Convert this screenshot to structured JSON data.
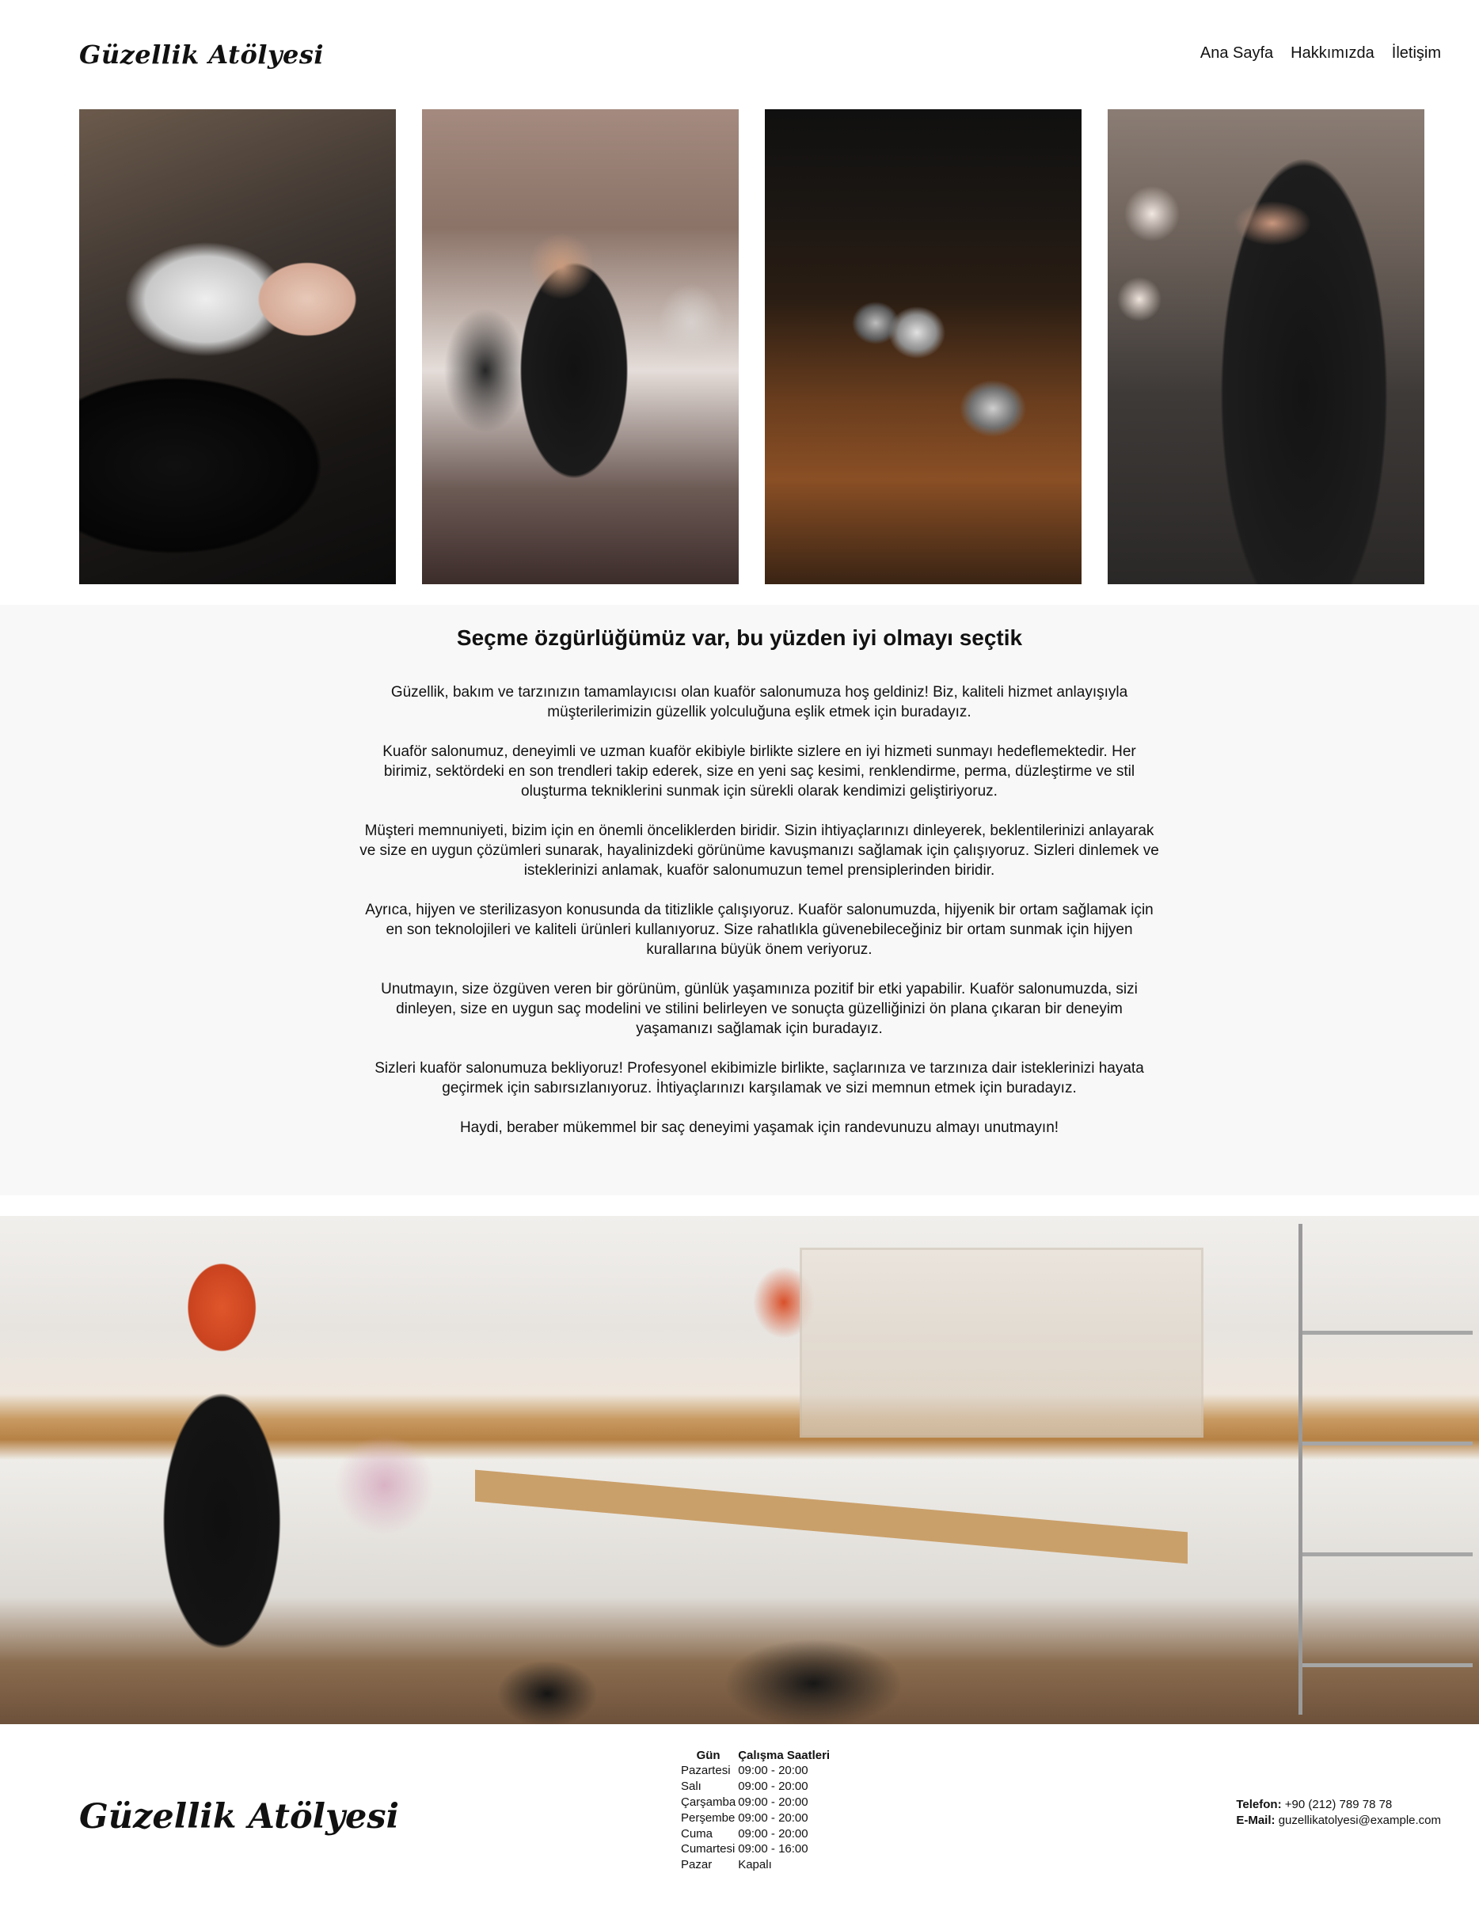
{
  "header": {
    "logo": "Güzellik Atölyesi",
    "nav": [
      "Ana Sayfa",
      "Hakkımızda",
      "İletişim"
    ]
  },
  "gallery": {
    "images": [
      {
        "subject": "hair-wash-photo"
      },
      {
        "subject": "stylists-working-photo"
      },
      {
        "subject": "scissors-on-wood-photo"
      },
      {
        "subject": "barber-tool-belt-photo"
      }
    ]
  },
  "intro": {
    "title": "Seçme özgürlüğümüz var, bu yüzden iyi olmayı seçtik",
    "paragraphs": [
      "Güzellik, bakım ve tarzınızın tamamlayıcısı olan kuaför salonumuza hoş geldiniz! Biz, kaliteli hizmet anlayışıyla müşterilerimizin güzellik yolculuğuna eşlik etmek için buradayız.",
      "Kuaför salonumuz, deneyimli ve uzman kuaför ekibiyle birlikte sizlere en iyi hizmeti sunmayı hedeflemektedir. Her birimiz, sektördeki en son trendleri takip ederek, size en yeni saç kesimi, renklendirme, perma, düzleştirme ve stil oluşturma tekniklerini sunmak için sürekli olarak kendimizi geliştiriyoruz.",
      "Müşteri memnuniyeti, bizim için en önemli önceliklerden biridir. Sizin ihtiyaçlarınızı dinleyerek, beklentilerinizi anlayarak ve size en uygun çözümleri sunarak, hayalinizdeki görünüme kavuşmanızı sağlamak için çalışıyoruz. Sizleri dinlemek ve isteklerinizi anlamak, kuaför salonumuzun temel prensiplerinden biridir.",
      "Ayrıca, hijyen ve sterilizasyon konusunda da titizlikle çalışıyoruz. Kuaför salonumuzda, hijyenik bir ortam sağlamak için en son teknolojileri ve kaliteli ürünleri kullanıyoruz. Size rahatlıkla güvenebileceğiniz bir ortam sunmak için hijyen kurallarına büyük önem veriyoruz.",
      "Unutmayın, size özgüven veren bir görünüm, günlük yaşamınıza pozitif bir etki yapabilir. Kuaför salonumuzda, sizi dinleyen, size en uygun saç modelini ve stilini belirleyen ve sonuçta güzelliğinizi ön plana çıkaran bir deneyim yaşamanızı sağlamak için buradayız.",
      "Sizleri kuaför salonumuza bekliyoruz! Profesyonel ekibimizle birlikte, saçlarınıza ve tarzınıza dair isteklerinizi hayata geçirmek için sabırsızlanıyoruz. İhtiyaçlarınızı karşılamak ve sizi memnun etmek için buradayız.",
      "Haydi, beraber mükemmel bir saç deneyimi yaşamak için randevunuzu almayı unutmayın!"
    ]
  },
  "footer": {
    "logo": "Güzellik Atölyesi",
    "hours": {
      "headers": [
        "Gün",
        "Çalışma Saatleri"
      ],
      "rows": [
        [
          "Pazartesi",
          "09:00 - 20:00"
        ],
        [
          "Salı",
          "09:00 - 20:00"
        ],
        [
          "Çarşamba",
          "09:00 - 20:00"
        ],
        [
          "Perşembe",
          "09:00 - 20:00"
        ],
        [
          "Cuma",
          "09:00 - 20:00"
        ],
        [
          "Cumartesi",
          "09:00 - 16:00"
        ],
        [
          "Pazar",
          "Kapalı"
        ]
      ]
    },
    "contact": {
      "phone_label": "Telefon:",
      "phone": "+90 (212) 789 78 78",
      "email_label": "E-Mail:",
      "email": "guzellikatolyesi@example.com"
    }
  }
}
